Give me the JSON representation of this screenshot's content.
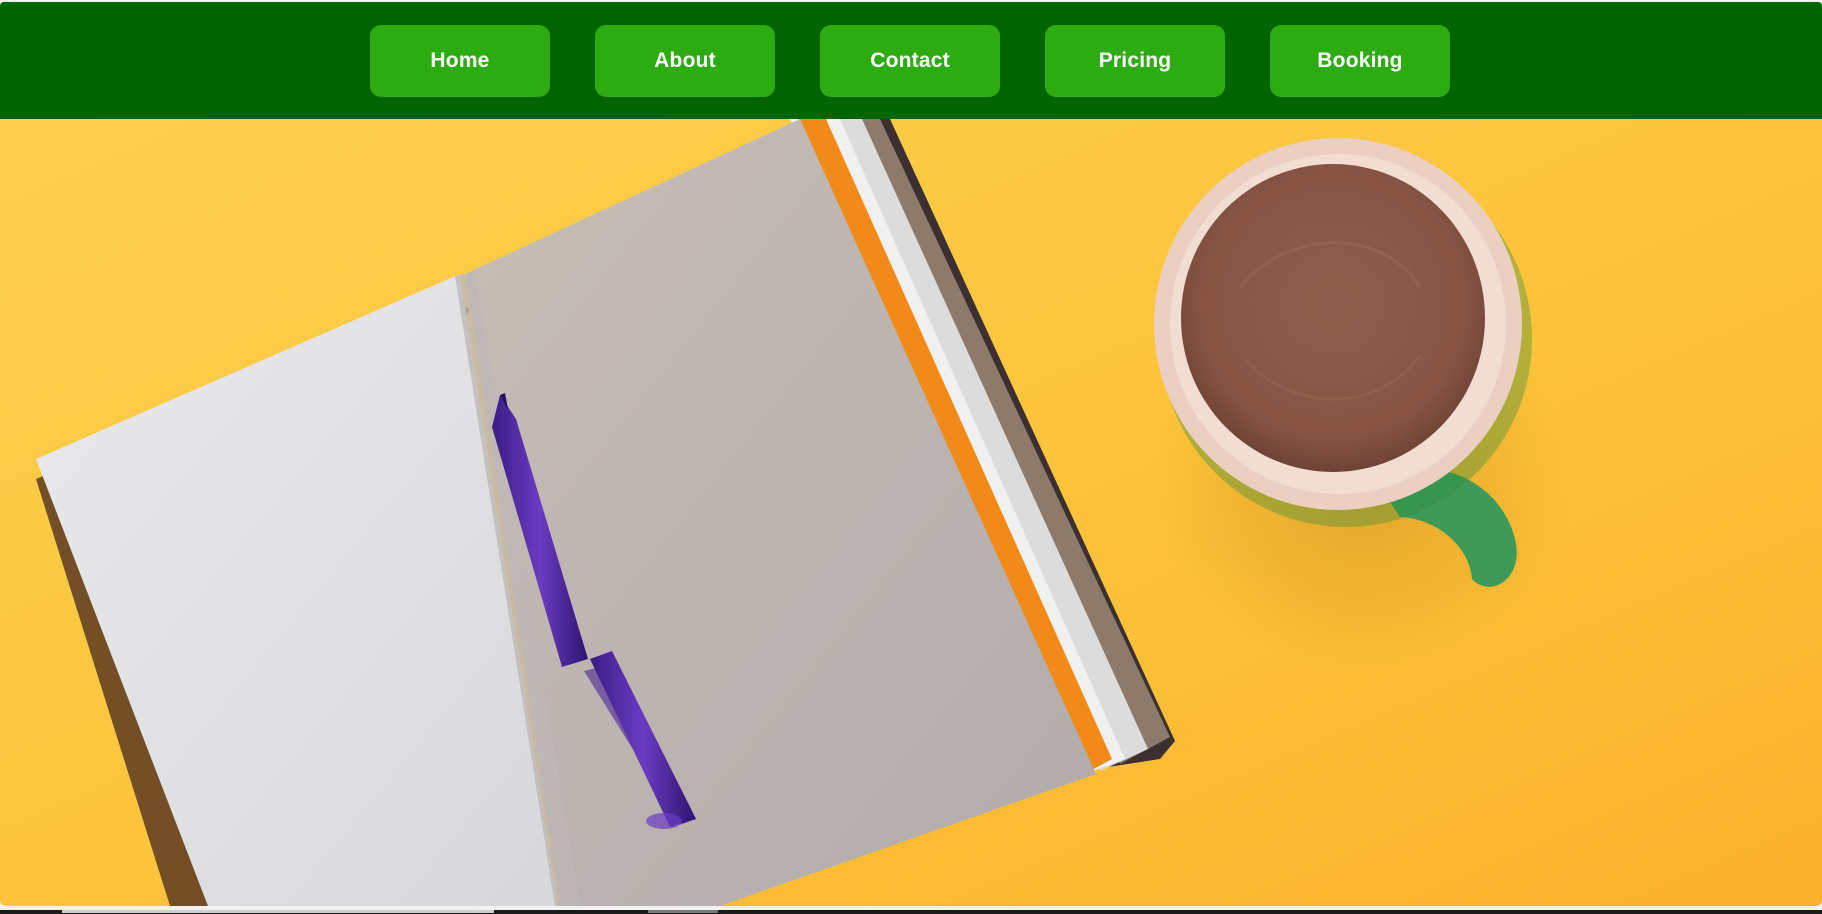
{
  "nav": {
    "items": [
      {
        "label": "Home"
      },
      {
        "label": "About"
      },
      {
        "label": "Contact"
      },
      {
        "label": "Pricing"
      },
      {
        "label": "Booking"
      }
    ]
  },
  "colors": {
    "navbar_bg": "#006400",
    "nav_button_bg": "#2dac12",
    "nav_button_text": "#ffffff",
    "hero_background": "#fec53a"
  },
  "hero": {
    "image_subject": "open notebook with purple pen beside cup of hot cocoa on yellow background",
    "icons": [
      "notebook-icon",
      "pen-icon",
      "cocoa-cup-icon"
    ]
  }
}
